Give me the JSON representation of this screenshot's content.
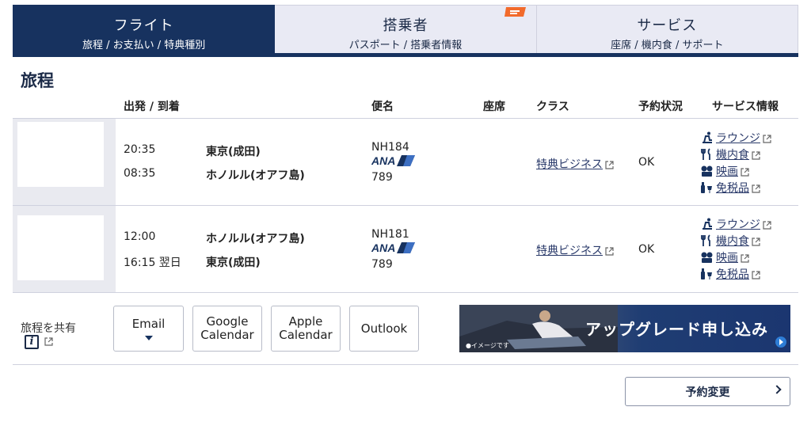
{
  "tabs": [
    {
      "title": "フライト",
      "subtitle": "旅程 / お支払い / 特典種別"
    },
    {
      "title": "搭乗者",
      "subtitle": "パスポート / 搭乗者情報"
    },
    {
      "title": "サービス",
      "subtitle": "座席 / 機内食 / サポート"
    }
  ],
  "section_title": "旅程",
  "columns": {
    "depart_arrive": "出発 / 到着",
    "flight": "便名",
    "seat": "座席",
    "class": "クラス",
    "status": "予約状況",
    "services": "サービス情報"
  },
  "flights": [
    {
      "dep_time": "20:35",
      "dep_city": "東京(成田)",
      "arr_time": "08:35",
      "arr_city": "ホノルル(オアフ島)",
      "flight_no": "NH184",
      "aircraft": "789",
      "fare": "特典ビジネス",
      "status": "OK"
    },
    {
      "dep_time": "12:00",
      "dep_city": "ホノルル(オアフ島)",
      "arr_time": "16:15 翌日",
      "arr_city": "東京(成田)",
      "flight_no": "NH181",
      "aircraft": "789",
      "fare": "特典ビジネス",
      "status": "OK"
    }
  ],
  "services": {
    "lounge": "ラウンジ",
    "meal": "機内食",
    "movie": "映画",
    "dutyfree": "免税品"
  },
  "share": {
    "label": "旅程を共有",
    "email": "Email",
    "google": [
      "Google",
      "Calendar"
    ],
    "apple": [
      "Apple",
      "Calendar"
    ],
    "outlook": "Outlook"
  },
  "banner": {
    "text": "アップグレード申し込み",
    "note": "●イメージです"
  },
  "change_button": "予約変更",
  "colors": {
    "navy": "#17325f",
    "tab_bg": "#e9eaf4",
    "link": "#2a3a6a",
    "accent_orange": "#f26a2b"
  },
  "logo": {
    "text": "ANA"
  }
}
